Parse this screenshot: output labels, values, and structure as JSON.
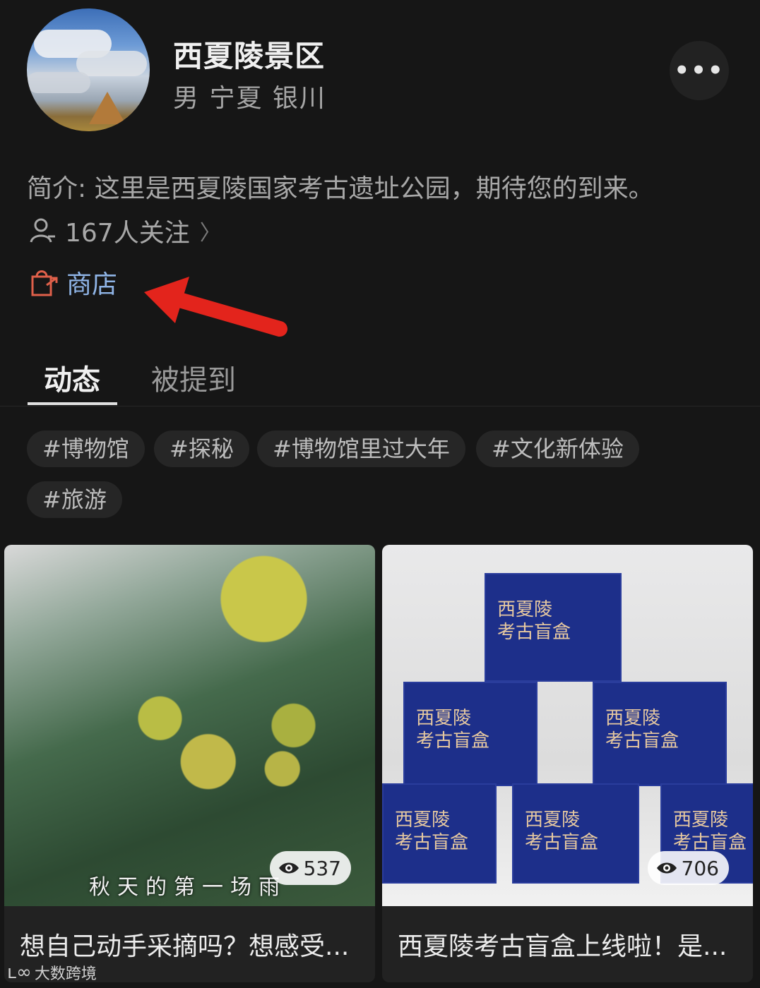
{
  "profile": {
    "name": "西夏陵景区",
    "meta": "男 宁夏 银川",
    "bio": "简介: 这里是西夏陵国家考古遗址公园，期待您的到来。",
    "followers": "167人关注",
    "shop_label": "商店"
  },
  "tabs": [
    {
      "label": "动态",
      "active": true
    },
    {
      "label": "被提到",
      "active": false
    }
  ],
  "tags": [
    "#博物馆",
    "#探秘",
    "#博物馆里过大年",
    "#文化新体验",
    "#旅游"
  ],
  "posts": [
    {
      "caption": "想自己动手采摘吗？想感受...",
      "views": "537",
      "overlay": "秋天的第一场雨"
    },
    {
      "caption": "西夏陵考古盲盒上线啦！是...",
      "views": "706",
      "box_text": "西夏陵\n考古盲盒"
    }
  ],
  "watermark": "大数跨境",
  "colors": {
    "background": "#161616",
    "shop_icon": "#e0604a",
    "shop_text": "#8fb4e6",
    "annotation_arrow": "#e3241c"
  },
  "icons": {
    "more": "more-dots-icon",
    "followers": "user-icon",
    "shop": "shopping-bag-icon",
    "views": "eye-icon"
  }
}
